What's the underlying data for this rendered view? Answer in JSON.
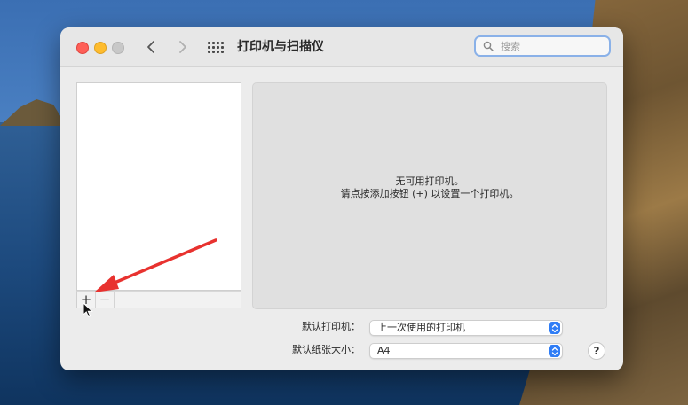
{
  "window": {
    "title": "打印机与扫描仪"
  },
  "search": {
    "placeholder": "搜索"
  },
  "list_bar": {
    "add_label": "+",
    "remove_label": "−"
  },
  "detail": {
    "line1": "无可用打印机。",
    "line2": "请点按添加按钮 (+) 以设置一个打印机。"
  },
  "default_printer": {
    "label": "默认打印机：",
    "value": "上一次使用的打印机"
  },
  "default_paper": {
    "label": "默认纸张大小：",
    "value": "A4"
  },
  "help": {
    "label": "?"
  },
  "colors": {
    "accent": "#2f7df6",
    "annotation_arrow": "#e8322f"
  },
  "icons": [
    "chevron-left-icon",
    "chevron-right-icon",
    "grid-icon",
    "search-icon",
    "stepper-icon",
    "cursor-icon"
  ]
}
